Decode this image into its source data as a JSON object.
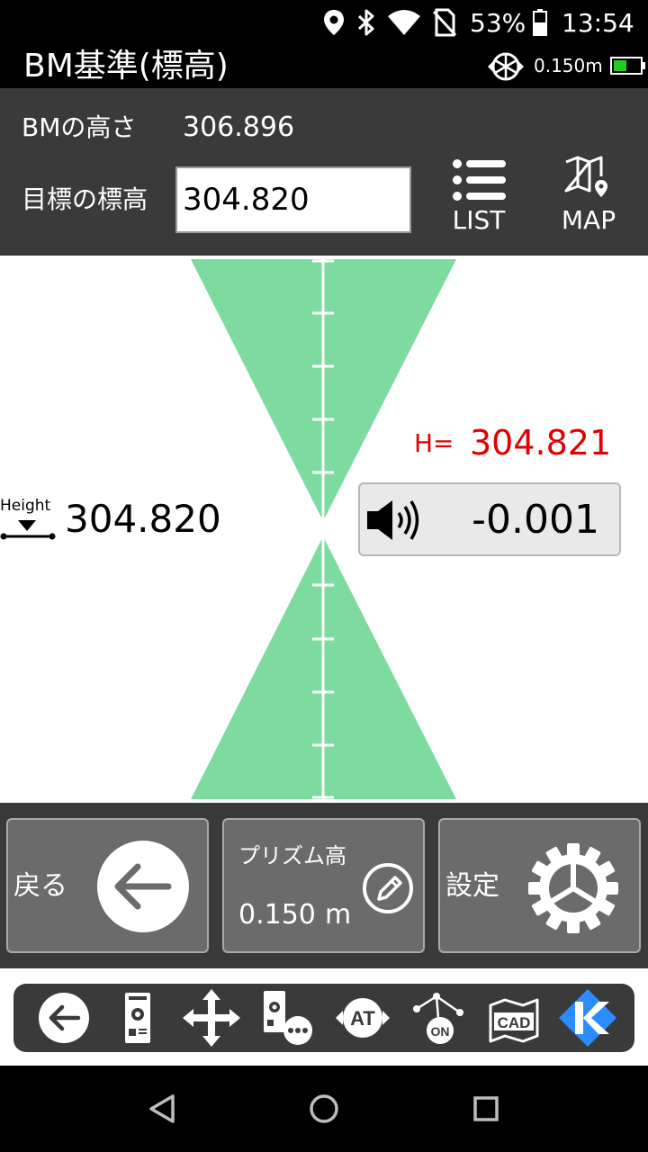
{
  "status_bar": {
    "battery_percent": "53%",
    "time": "13:54",
    "icons": [
      "location-icon",
      "bluetooth-icon",
      "wifi-icon",
      "no-sim-icon",
      "battery-icon"
    ]
  },
  "title_bar": {
    "title": "BM基準(標高)",
    "prism_height": "0.150m",
    "icons": [
      "prism-icon",
      "battery-level-icon"
    ],
    "colors": {
      "battery_fill": "#22cc22"
    }
  },
  "header": {
    "bm_label": "BMの高さ",
    "bm_value": "306.896",
    "target_label": "目標の標高",
    "target_value": "304.820",
    "list_label": "LIST",
    "map_label": "MAP",
    "icons": [
      "list-icon",
      "map-icon"
    ]
  },
  "guide": {
    "height_tag": "Height",
    "height_value": "304.820",
    "h_label": "H=",
    "h_value": "304.821",
    "difference": "-0.001",
    "colors": {
      "triangle": "#7ddba0",
      "measured": "#e00000"
    },
    "icons": [
      "height-marker-icon",
      "speaker-icon"
    ]
  },
  "buttons": {
    "back_label": "戻る",
    "prism_label": "プリズム高",
    "prism_value": "0.150",
    "prism_unit": "m",
    "settings_label": "設定",
    "icons": [
      "arrow-left-circle-icon",
      "pencil-circle-icon",
      "gear-icon"
    ]
  },
  "toolbar": {
    "items": [
      "back-icon",
      "instrument-icon",
      "move-icon",
      "instrument-more-icon",
      "at-icon",
      "on-network-icon",
      "cad-icon",
      "k-logo-icon"
    ],
    "colors": {
      "k_logo": "#2a8cff"
    }
  },
  "nav_bar": {
    "items": [
      "nav-back-icon",
      "nav-home-icon",
      "nav-recent-icon"
    ]
  }
}
